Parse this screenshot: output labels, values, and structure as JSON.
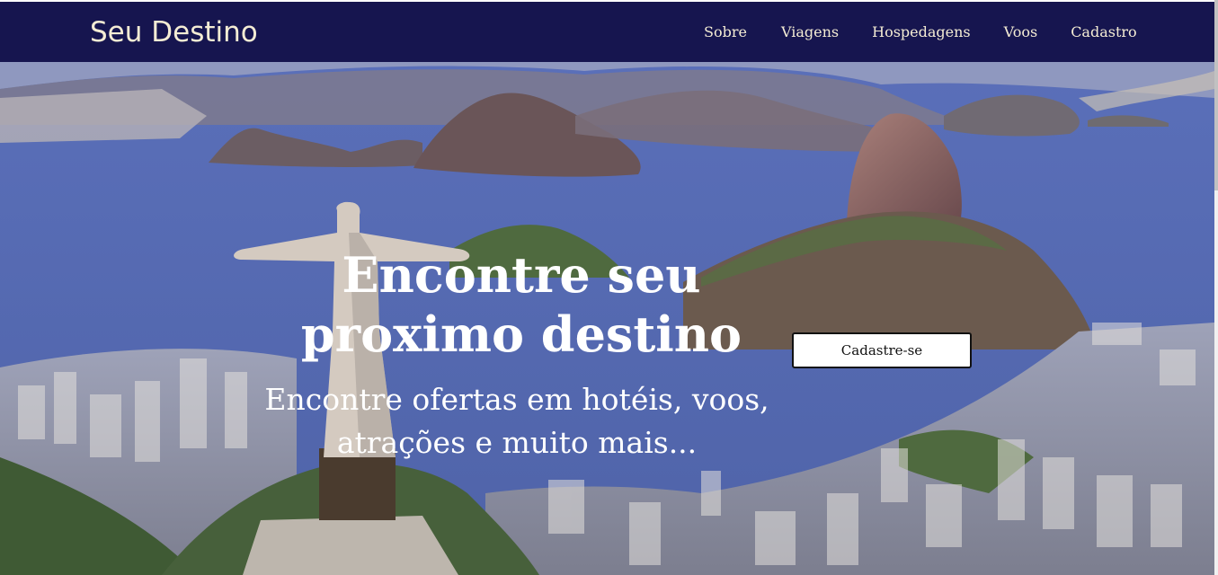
{
  "brand": {
    "name": "Seu Destino"
  },
  "nav": {
    "items": [
      {
        "label": "Sobre"
      },
      {
        "label": "Viagens"
      },
      {
        "label": "Hospedagens"
      },
      {
        "label": "Voos"
      },
      {
        "label": "Cadastro"
      }
    ]
  },
  "hero": {
    "title_line1": "Encontre seu",
    "title_line2": "proximo destino",
    "subtitle_line1": "Encontre ofertas em hotéis, voos,",
    "subtitle_line2": "atrações e muito mais...",
    "cta_label": "Cadastre-se",
    "background_image": "rio-de-janeiro-aerial-view"
  },
  "colors": {
    "navbar_bg": "#16154f",
    "nav_text": "#f4ecd4",
    "hero_text": "#ffffff",
    "button_bg": "#ffffff"
  }
}
